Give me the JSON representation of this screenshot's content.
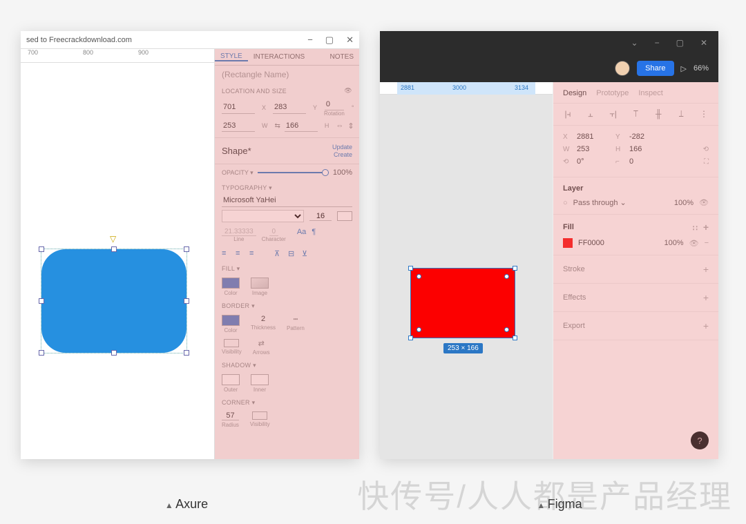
{
  "captions": {
    "left": "Axure",
    "right": "Figma"
  },
  "watermark": "快传号/人人都是产品经理",
  "axure": {
    "title": "sed to Freecrackdownload.com",
    "ruler": [
      "700",
      "800",
      "900"
    ],
    "tabs": {
      "style": "STYLE",
      "interactions": "INTERACTIONS",
      "notes": "NOTES"
    },
    "name_placeholder": "(Rectangle Name)",
    "section_location": "LOCATION AND SIZE",
    "x": "701",
    "y": "283",
    "rot": "0",
    "rot_label": "Rotation",
    "w": "253",
    "h": "166",
    "xl": "X",
    "yl": "Y",
    "wl": "W",
    "hl": "H",
    "shape_title": "Shape*",
    "update": "Update",
    "create": "Create",
    "opacity_label": "OPACITY ▾",
    "opacity": "100%",
    "typo_label": "TYPOGRAPHY ▾",
    "font": "Microsoft YaHei",
    "font_size": "16",
    "line_val": "21.33333",
    "line_lbl": "Line",
    "char_val": "0",
    "char_lbl": "Character",
    "fill_label": "FILL ▾",
    "fill_color": "Color",
    "fill_image": "Image",
    "border_label": "BORDER ▾",
    "border_color": "Color",
    "border_thick": "2",
    "border_thick_lbl": "Thickness",
    "border_pattern": "Pattern",
    "border_visibility": "Visibility",
    "border_arrows": "Arrows",
    "shadow_label": "SHADOW ▾",
    "shadow_outer": "Outer",
    "shadow_inner": "Inner",
    "corner_label": "CORNER ▾",
    "corner_radius": "57",
    "corner_radius_lbl": "Radius",
    "corner_vis": "Visibility"
  },
  "figma": {
    "share": "Share",
    "zoom": "66%",
    "ruler": {
      "a": "2881",
      "b": "3000",
      "c": "3134"
    },
    "tabs": {
      "design": "Design",
      "prototype": "Prototype",
      "inspect": "Inspect"
    },
    "x": "2881",
    "y": "-282",
    "w": "253",
    "h": "166",
    "rot": "0°",
    "radius": "0",
    "xl": "X",
    "yl": "Y",
    "wl": "W",
    "hl": "H",
    "layer_title": "Layer",
    "pass": "Pass through",
    "pass_pct": "100%",
    "fill_title": "Fill",
    "fill_hex": "FF0000",
    "fill_pct": "100%",
    "stroke": "Stroke",
    "effects": "Effects",
    "export": "Export",
    "size_badge": "253 × 166"
  }
}
